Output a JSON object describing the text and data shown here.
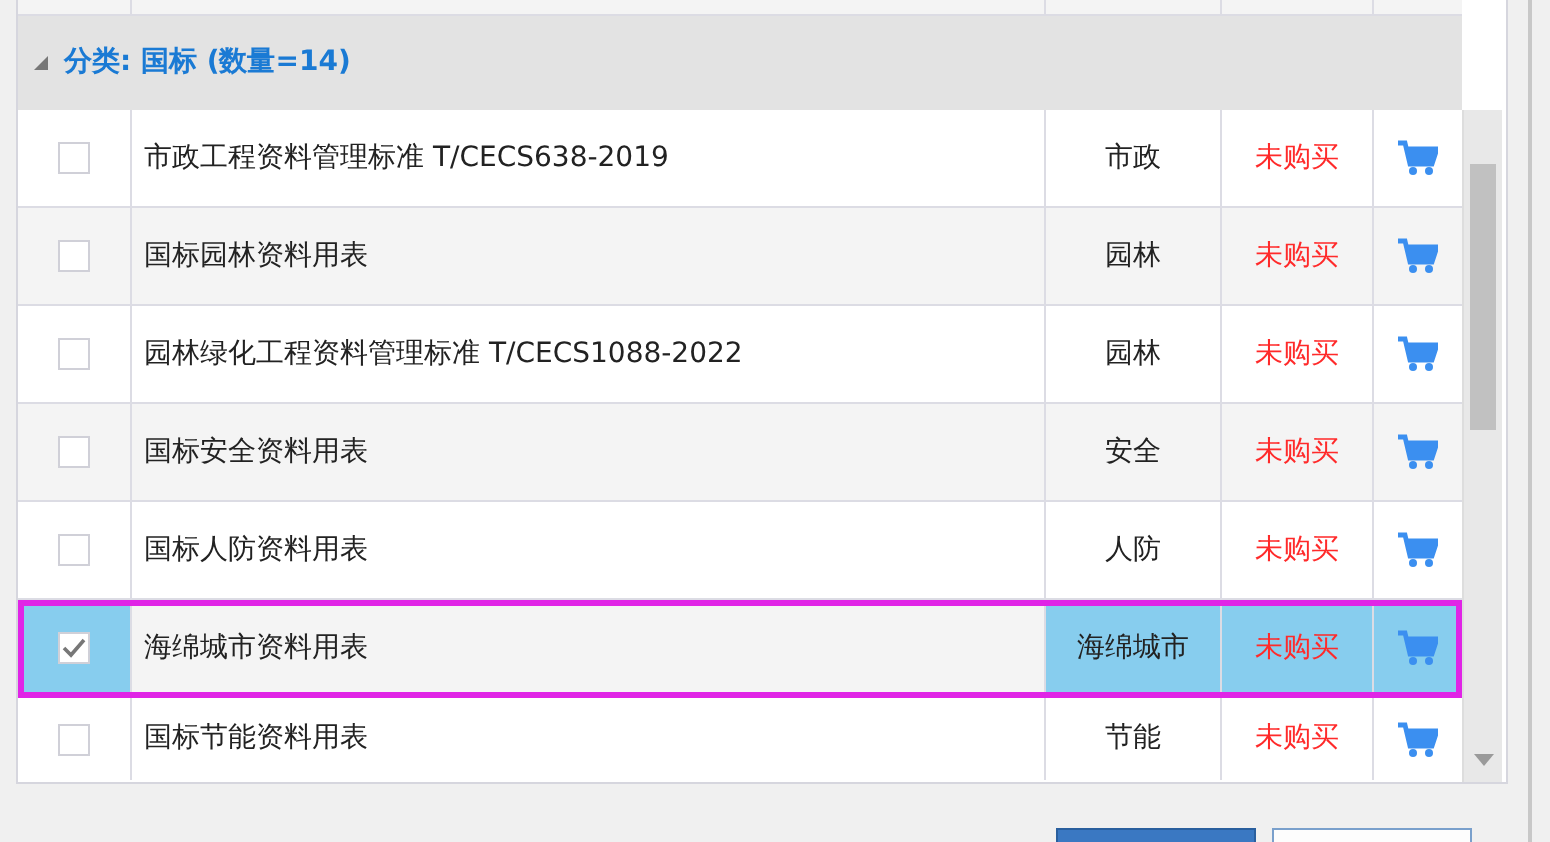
{
  "group": {
    "label": "分类: 国标 (数量=14)",
    "expanded": true
  },
  "rows": [
    {
      "name": "市政工程资料管理标准  T/CECS638-2019",
      "category": "市政",
      "status": "未购买",
      "checked": false,
      "selected": false
    },
    {
      "name": "国标园林资料用表",
      "category": "园林",
      "status": "未购买",
      "checked": false,
      "selected": false
    },
    {
      "name": "园林绿化工程资料管理标准  T/CECS1088-2022",
      "category": "园林",
      "status": "未购买",
      "checked": false,
      "selected": false
    },
    {
      "name": "国标安全资料用表",
      "category": "安全",
      "status": "未购买",
      "checked": false,
      "selected": false
    },
    {
      "name": "国标人防资料用表",
      "category": "人防",
      "status": "未购买",
      "checked": false,
      "selected": false
    },
    {
      "name": "海绵城市资料用表",
      "category": "海绵城市",
      "status": "未购买",
      "checked": true,
      "selected": true
    },
    {
      "name": "国标节能资料用表",
      "category": "节能",
      "status": "未购买",
      "checked": false,
      "selected": false
    }
  ]
}
